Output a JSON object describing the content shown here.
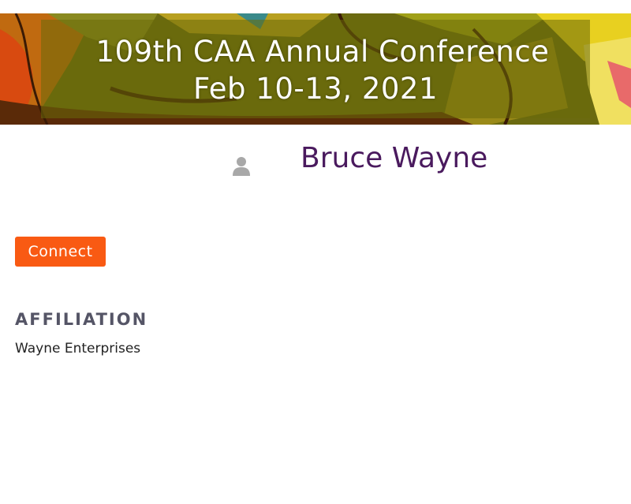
{
  "banner": {
    "line1": "109th CAA Annual Conference",
    "line2": "Feb 10-13, 2021"
  },
  "profile": {
    "name": "Bruce Wayne",
    "avatar_icon": "person-icon"
  },
  "actions": {
    "connect_label": "Connect"
  },
  "affiliation": {
    "heading": "AFFILIATION",
    "value": "Wayne Enterprises"
  },
  "colors": {
    "name_color": "#4a1a5e",
    "connect_bg": "#f95a13",
    "heading_color": "#555566"
  }
}
